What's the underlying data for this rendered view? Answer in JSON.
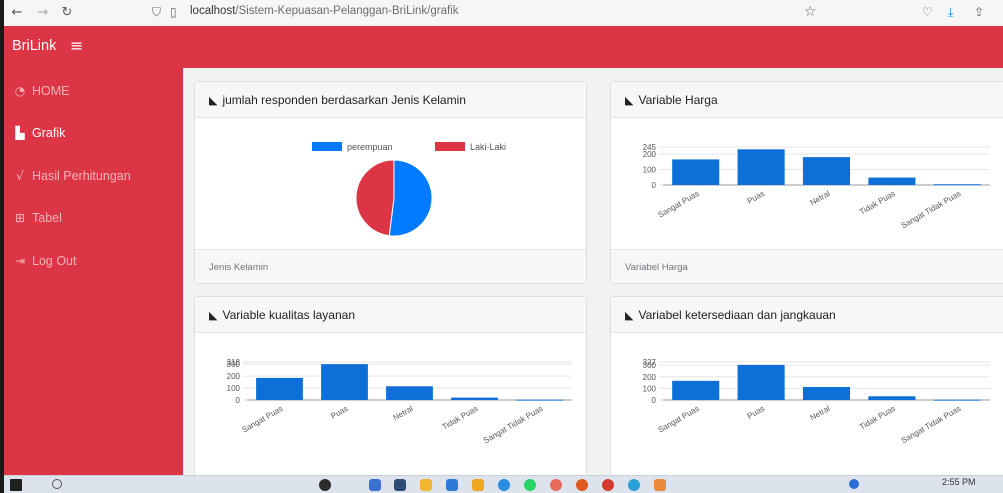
{
  "browser": {
    "url_host": "localhost",
    "url_path": "/Sistem-Kepuasan-Pelanggan-BriLink/grafik"
  },
  "app": {
    "brand": "BriLink",
    "menu_icon": "hamburger-icon"
  },
  "sidebar": {
    "items": [
      {
        "label": "HOME",
        "icon": "tachometer-icon"
      },
      {
        "label": "Grafik",
        "icon": "bar-chart-icon",
        "active": true
      },
      {
        "label": "Hasil Perhitungan",
        "icon": "square-root-icon"
      },
      {
        "label": "Tabel",
        "icon": "table-icon"
      },
      {
        "label": "Log Out",
        "icon": "sign-out-icon"
      }
    ]
  },
  "cards": {
    "gender": {
      "title": "jumlah responden berdasarkan Jenis Kelamin",
      "footer": "Jenis Kelamin"
    },
    "harga": {
      "title": "Variable Harga",
      "footer": "Variabel Harga"
    },
    "kualitas": {
      "title": "Variable kualitas layanan"
    },
    "ketersediaan": {
      "title": "Variabel ketersediaan dan jangkauan"
    }
  },
  "colors": {
    "brand": "#dc3545",
    "blue": "#007bff",
    "bar": "#0f6fd8"
  },
  "taskbar": {
    "time": "2:55 PM"
  },
  "chart_data": [
    {
      "type": "pie",
      "categories": [
        "perempuan",
        "Laki-Laki"
      ],
      "values": [
        52,
        48
      ],
      "colors": [
        "#007bff",
        "#dc3545"
      ],
      "legend": "top"
    },
    {
      "type": "bar",
      "categories": [
        "Sangat Puas",
        "Puas",
        "Netral",
        "Tidak Puas",
        "Sangat Tidak Puas"
      ],
      "values": [
        165,
        230,
        180,
        48,
        5
      ],
      "yticks": [
        "0",
        "100",
        "200",
        "245"
      ],
      "ylim": [
        0,
        245
      ],
      "grid": true
    },
    {
      "type": "bar",
      "categories": [
        "Sangat Puas",
        "Puas",
        "Netral",
        "Tidak Puas",
        "Sangat Tidak Puas"
      ],
      "values": [
        185,
        300,
        115,
        20,
        3
      ],
      "yticks": [
        "0",
        "100",
        "200",
        "300",
        "318"
      ],
      "ylim": [
        0,
        318
      ],
      "grid": true
    },
    {
      "type": "bar",
      "categories": [
        "Sangat Puas",
        "Puas",
        "Netral",
        "Tidak Puas",
        "Sangat Tidak Puas"
      ],
      "values": [
        165,
        302,
        112,
        32,
        3
      ],
      "yticks": [
        "0",
        "100",
        "200",
        "300",
        "327"
      ],
      "ylim": [
        0,
        327
      ],
      "grid": true
    }
  ]
}
